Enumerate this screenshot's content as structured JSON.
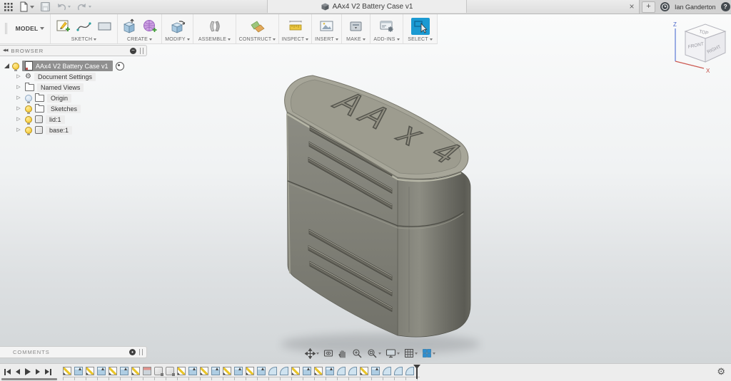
{
  "titlebar": {
    "tab_title": "AAx4 V2 Battery Case v1",
    "user_name": "Ian Ganderton",
    "close_tab": "×",
    "new_tab": "+",
    "help": "?"
  },
  "toolbar": {
    "workspace_label": "MODEL",
    "accent_color": "#1b9ad2",
    "groups": [
      {
        "label": "SKETCH"
      },
      {
        "label": "CREATE"
      },
      {
        "label": "MODIFY"
      },
      {
        "label": "ASSEMBLE"
      },
      {
        "label": "CONSTRUCT"
      },
      {
        "label": "INSPECT"
      },
      {
        "label": "INSERT"
      },
      {
        "label": "MAKE"
      },
      {
        "label": "ADD-INS"
      },
      {
        "label": "SELECT"
      }
    ],
    "active_tool": "SELECT"
  },
  "browser": {
    "header": "BROWSER",
    "root_label": "AAx4 V2 Battery Case v1",
    "items": [
      {
        "label": "Document Settings",
        "icon": "gear",
        "bulb": "none"
      },
      {
        "label": "Named Views",
        "icon": "folder",
        "bulb": "none"
      },
      {
        "label": "Origin",
        "icon": "folder",
        "bulb": "off"
      },
      {
        "label": "Sketches",
        "icon": "folder",
        "bulb": "on"
      },
      {
        "label": "lid:1",
        "icon": "component",
        "bulb": "on"
      },
      {
        "label": "base:1",
        "icon": "component",
        "bulb": "on"
      }
    ]
  },
  "viewcube": {
    "top": "TOP",
    "front": "FRONT",
    "right": "RIGHT",
    "axis_z": "Z",
    "axis_x": "X"
  },
  "canvas": {
    "model_engraving": "AA x 4",
    "model_color": "#84847b"
  },
  "comments": {
    "header": "COMMENTS"
  },
  "navbar": {
    "items": [
      {
        "name": "orbit",
        "dropdown": true
      },
      {
        "name": "look-at",
        "dropdown": false
      },
      {
        "name": "pan",
        "dropdown": false
      },
      {
        "name": "zoom",
        "dropdown": false
      },
      {
        "name": "zoom-window",
        "dropdown": true
      },
      {
        "name": "display-settings",
        "dropdown": true
      },
      {
        "name": "grid-layout",
        "dropdown": true
      },
      {
        "name": "viewports",
        "dropdown": true
      }
    ]
  },
  "timeline": {
    "playback": [
      "go-to-start",
      "step-back",
      "play",
      "step-forward",
      "go-to-end"
    ],
    "features": [
      "sketch",
      "extrude",
      "sketch",
      "extrude",
      "sketch",
      "extrude",
      "sketch",
      "shell",
      "component",
      "component",
      "sketch",
      "extrude",
      "sketch",
      "extrude",
      "sketch",
      "extrude",
      "sketch",
      "extrude",
      "fillet",
      "fillet",
      "sketch",
      "extrude",
      "sketch",
      "extrude",
      "fillet",
      "fillet",
      "sketch",
      "extrude",
      "fillet",
      "fillet",
      "fillet"
    ]
  }
}
